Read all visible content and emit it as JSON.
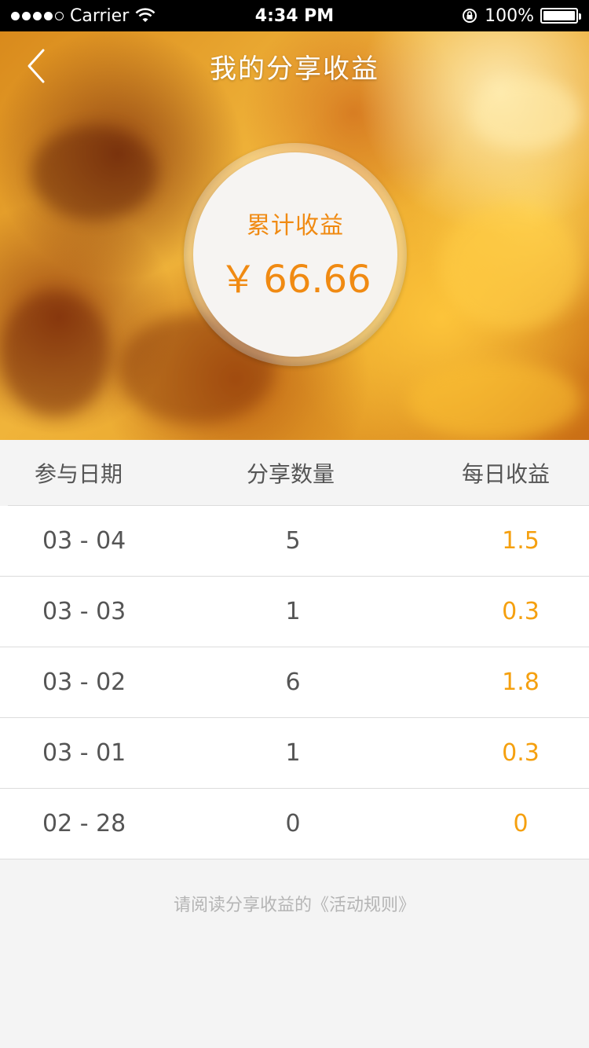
{
  "status_bar": {
    "carrier": "Carrier",
    "time": "4:34 PM",
    "battery": "100%"
  },
  "nav": {
    "title": "我的分享收益"
  },
  "earnings": {
    "label": "累计收益",
    "currency": "￥",
    "amount": "66.66"
  },
  "table": {
    "headers": {
      "date": "参与日期",
      "count": "分享数量",
      "daily": "每日收益"
    },
    "rows": [
      {
        "date": "03 - 04",
        "count": "5",
        "daily": "1.5"
      },
      {
        "date": "03 - 03",
        "count": "1",
        "daily": "0.3"
      },
      {
        "date": "03 - 02",
        "count": "6",
        "daily": "1.8"
      },
      {
        "date": "03 - 01",
        "count": "1",
        "daily": "0.3"
      },
      {
        "date": "02 - 28",
        "count": "0",
        "daily": "0"
      }
    ]
  },
  "footer": {
    "note": "请阅读分享收益的《活动规则》"
  },
  "colors": {
    "accent": "#f08a12",
    "daily_value": "#f5a00f"
  }
}
